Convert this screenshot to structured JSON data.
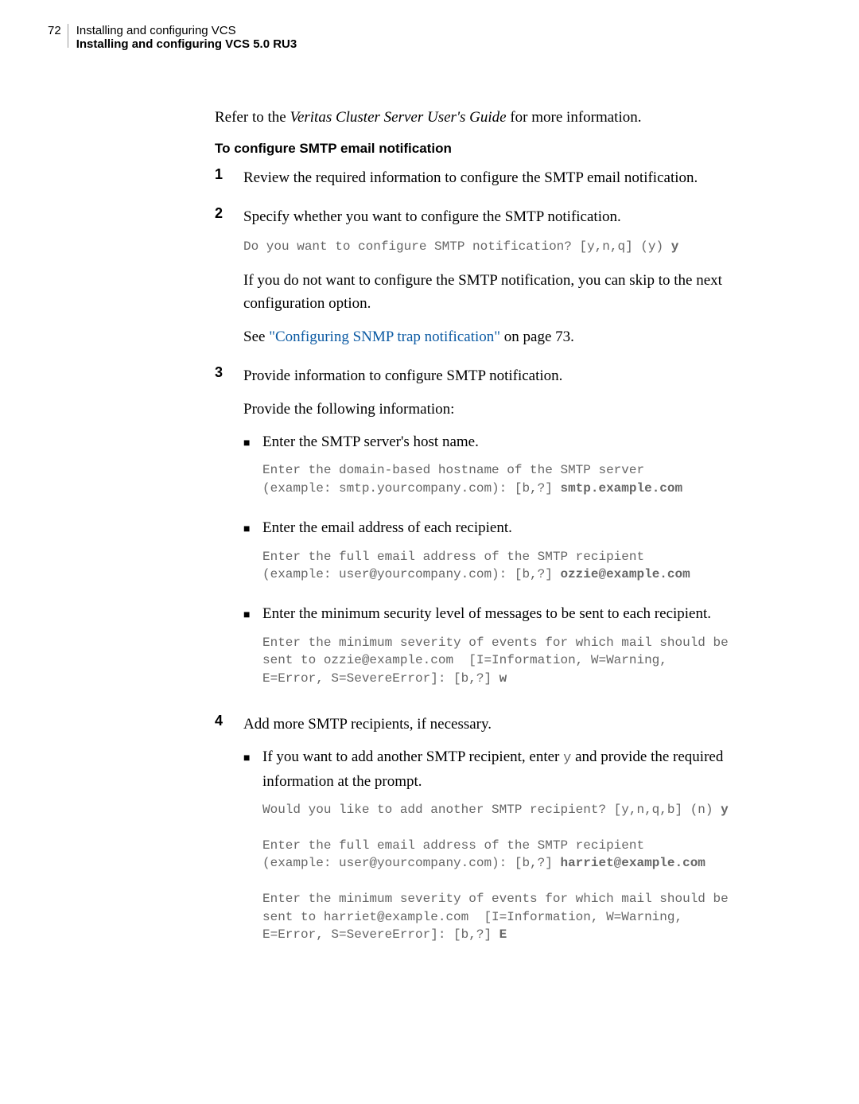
{
  "header": {
    "page_number": "72",
    "chapter": "Installing and configuring VCS",
    "section": "Installing and configuring VCS 5.0 RU3"
  },
  "intro": {
    "refer_prefix": "Refer to the ",
    "guide_title": "Veritas Cluster Server User's Guide",
    "refer_suffix": " for more information."
  },
  "subhead": "To configure SMTP email notification",
  "step1": {
    "num": "1",
    "text": "Review the required information to configure the SMTP email notification."
  },
  "step2": {
    "num": "2",
    "text": "Specify whether you want to configure the SMTP notification.",
    "code_line": "Do you want to configure SMTP notification? [y,n,q] (y) ",
    "code_answer": "y",
    "para2": "If you do not want to configure the SMTP notification, you can skip to the next configuration option.",
    "see_prefix": "See ",
    "see_link": "\"Configuring SNMP trap notification\"",
    "see_suffix": " on page 73."
  },
  "step3": {
    "num": "3",
    "text": "Provide information to configure SMTP notification.",
    "para2": "Provide the following information:",
    "bullet1": {
      "text": "Enter the SMTP server's host name.",
      "code_l1": "Enter the domain-based hostname of the SMTP server",
      "code_l2": "(example: smtp.yourcompany.com): [b,?] ",
      "code_ans": "smtp.example.com"
    },
    "bullet2": {
      "text": "Enter the email address of each recipient.",
      "code_l1": "Enter the full email address of the SMTP recipient",
      "code_l2": "(example: user@yourcompany.com): [b,?] ",
      "code_ans": "ozzie@example.com"
    },
    "bullet3": {
      "text": "Enter the minimum security level of messages to be sent to each recipient.",
      "code_l1": "Enter the minimum severity of events for which mail should be",
      "code_l2": "sent to ozzie@example.com  [I=Information, W=Warning,",
      "code_l3": "E=Error, S=SevereError]: [b,?] ",
      "code_ans": "w"
    }
  },
  "step4": {
    "num": "4",
    "text": "Add more SMTP recipients, if necessary.",
    "bullet1": {
      "text_prefix": "If you want to add another SMTP recipient, enter ",
      "code_y": "y",
      "text_suffix": " and provide the required information at the prompt.",
      "code_a1": "Would you like to add another SMTP recipient? [y,n,q,b] (n) ",
      "code_a1_ans": "y",
      "code_b1": "Enter the full email address of the SMTP recipient",
      "code_b2": "(example: user@yourcompany.com): [b,?] ",
      "code_b2_ans": "harriet@example.com",
      "code_c1": "Enter the minimum severity of events for which mail should be",
      "code_c2": "sent to harriet@example.com  [I=Information, W=Warning,",
      "code_c3": "E=Error, S=SevereError]: [b,?] ",
      "code_c3_ans": "E"
    }
  }
}
